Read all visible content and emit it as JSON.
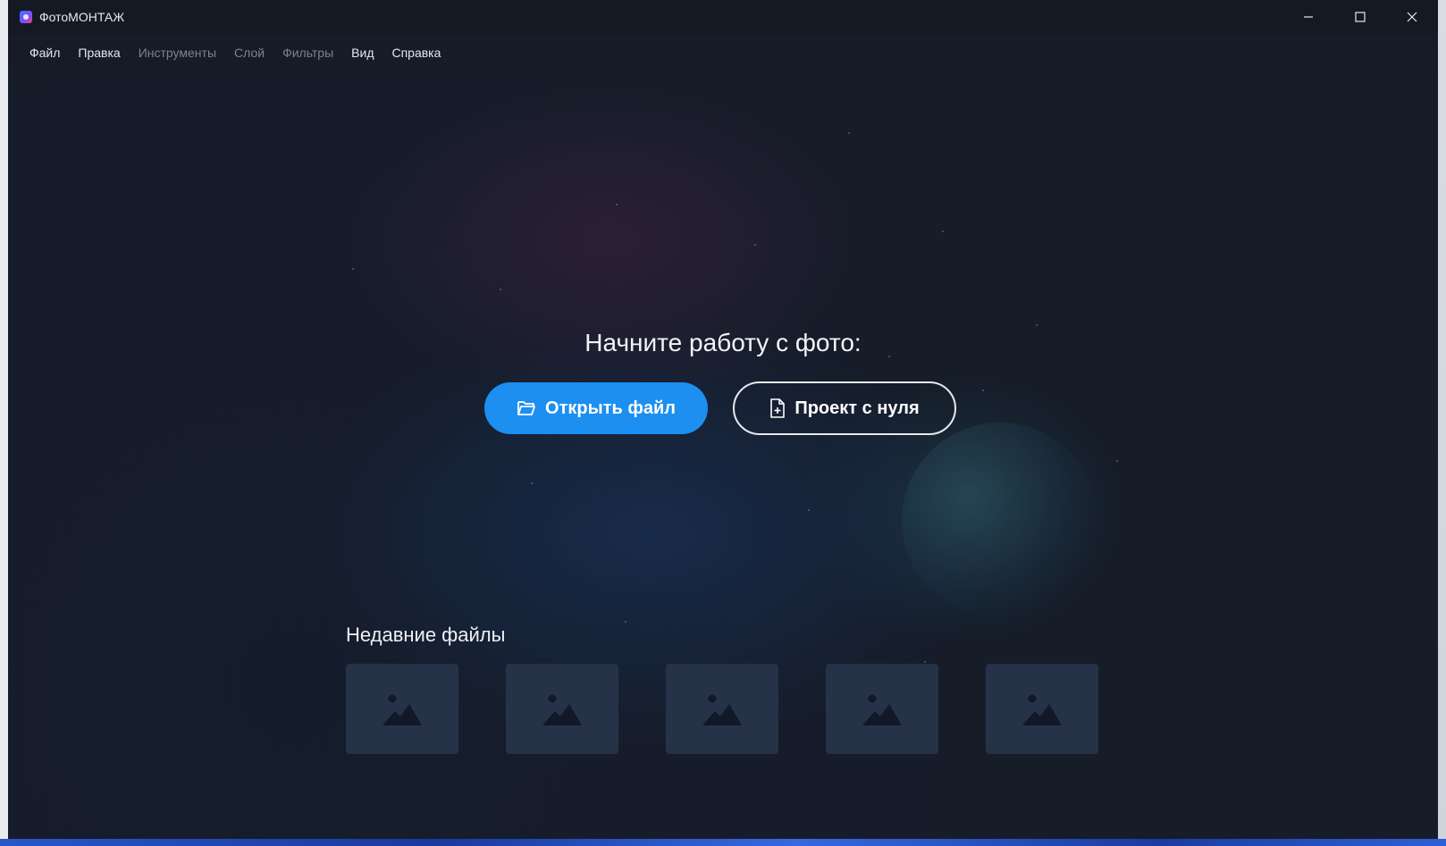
{
  "window": {
    "title": "ФотоМОНТАЖ"
  },
  "menu": {
    "items": [
      {
        "label": "Файл",
        "enabled": true
      },
      {
        "label": "Правка",
        "enabled": true
      },
      {
        "label": "Инструменты",
        "enabled": false
      },
      {
        "label": "Слой",
        "enabled": false
      },
      {
        "label": "Фильтры",
        "enabled": false
      },
      {
        "label": "Вид",
        "enabled": true
      },
      {
        "label": "Справка",
        "enabled": true
      }
    ]
  },
  "start": {
    "headline": "Начните работу с фото:",
    "open_file_label": "Открыть файл",
    "new_project_label": "Проект с нуля"
  },
  "recent": {
    "title": "Недавние файлы",
    "items": [
      {
        "icon": "image-placeholder-icon"
      },
      {
        "icon": "image-placeholder-icon"
      },
      {
        "icon": "image-placeholder-icon"
      },
      {
        "icon": "image-placeholder-icon"
      },
      {
        "icon": "image-placeholder-icon"
      }
    ]
  },
  "colors": {
    "primary_button": "#1c8ff0",
    "background": "#161b27",
    "thumbnail": "#263248"
  }
}
